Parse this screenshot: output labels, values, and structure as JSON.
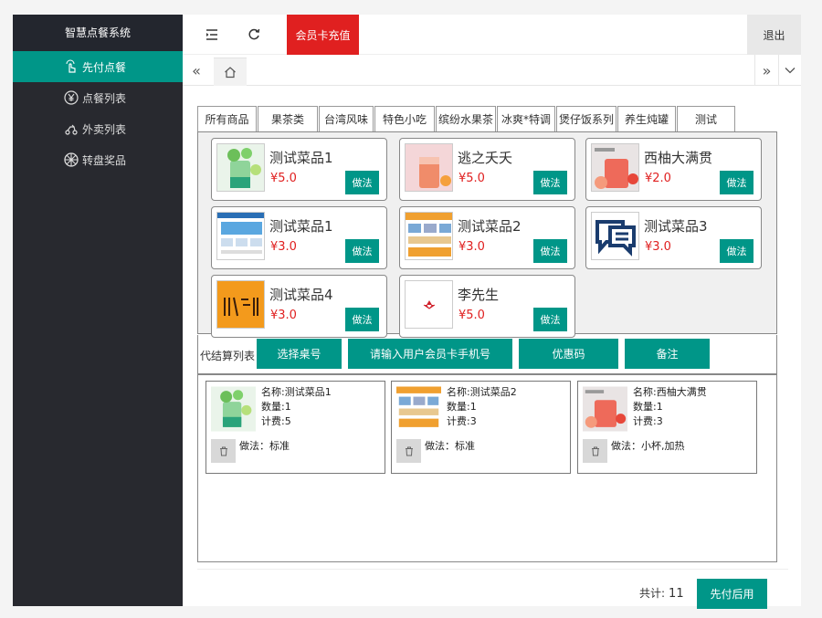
{
  "sidebar": {
    "brand": "智慧点餐系统",
    "items": [
      {
        "label": "先付点餐",
        "icon": "hand-tap-icon"
      },
      {
        "label": "点餐列表",
        "icon": "yen-circle-icon"
      },
      {
        "label": "外卖列表",
        "icon": "scooter-icon"
      },
      {
        "label": "转盘奖品",
        "icon": "wheel-icon"
      }
    ]
  },
  "header": {
    "recharge_label": "会员卡充值",
    "logout_label": "退出"
  },
  "categories": [
    "所有商品",
    "果茶类",
    "台湾风味",
    "特色小吃",
    "缤纷水果茶",
    "冰爽*特调",
    "煲仔饭系列",
    "养生炖罐",
    "测试"
  ],
  "menu": [
    {
      "name": "测试菜品1",
      "price": "¥5.0",
      "image": "mojito-drink"
    },
    {
      "name": "逃之夭夭",
      "price": "¥5.0",
      "image": "pink-tea"
    },
    {
      "name": "西柚大满贯",
      "price": "¥2.0",
      "image": "grapefruit-tea"
    },
    {
      "name": "测试菜品1",
      "price": "¥3.0",
      "image": "website-screenshot"
    },
    {
      "name": "测试菜品2",
      "price": "¥3.0",
      "image": "website-screenshot-2"
    },
    {
      "name": "测试菜品3",
      "price": "¥3.0",
      "image": "chat-icon"
    },
    {
      "name": "测试菜品4",
      "price": "¥3.0",
      "image": "orange-text"
    },
    {
      "name": "李先生",
      "price": "¥5.0",
      "image": "red-mark"
    }
  ],
  "make_label": "做法",
  "actions": {
    "label": "代结算列表",
    "buttons": [
      "选择桌号",
      "请输入用户会员卡手机号",
      "优惠码",
      "备注"
    ]
  },
  "order": [
    {
      "name": "名称:测试菜品1",
      "qty": "数量:1",
      "fee": "计费:5",
      "method": "做法：标准",
      "image": "mojito-drink"
    },
    {
      "name": "名称:测试菜品2",
      "qty": "数量:1",
      "fee": "计费:3",
      "method": "做法：标准",
      "image": "website-screenshot-2"
    },
    {
      "name": "名称:西柚大满贯",
      "qty": "数量:1",
      "fee": "计费:3",
      "method": "做法：小杯,加热",
      "image": "grapefruit-tea"
    }
  ],
  "footer": {
    "total_label": "共计:",
    "total_value": "11",
    "pay_label": "先付后用"
  },
  "colors": {
    "accent": "#009688",
    "sidebar": "#28292f",
    "danger": "#e02020"
  }
}
